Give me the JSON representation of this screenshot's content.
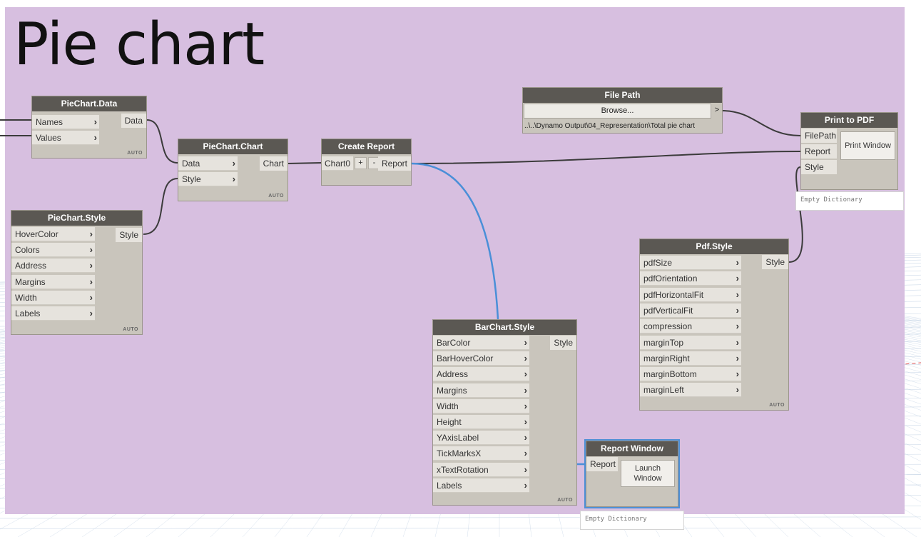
{
  "group": {
    "title": "Pie chart",
    "color": "#d7bfe0"
  },
  "nodes": {
    "piechart_data": {
      "title": "PieChart.Data",
      "inputs": [
        "Names",
        "Values"
      ],
      "output": "Data",
      "lacing": "AUTO"
    },
    "piechart_chart": {
      "title": "PieChart.Chart",
      "inputs": [
        "Data",
        "Style"
      ],
      "output": "Chart",
      "lacing": "AUTO"
    },
    "piechart_style": {
      "title": "PieChart.Style",
      "inputs": [
        "HoverColor",
        "Colors",
        "Address",
        "Margins",
        "Width",
        "Labels"
      ],
      "output": "Style",
      "lacing": "AUTO"
    },
    "create_report": {
      "title": "Create Report",
      "input": "Chart0",
      "add_label": "+",
      "remove_label": "-",
      "output": "Report"
    },
    "file_path": {
      "title": "File Path",
      "browse_label": "Browse...",
      "arrow_label": ">",
      "value": "..\\..\\Dynamo Output\\04_Representation\\Total pie chart"
    },
    "print_to_pdf": {
      "title": "Print to PDF",
      "inputs": [
        "FilePath",
        "Report",
        "Style"
      ],
      "button_label": "Print Window",
      "preview": "Empty Dictionary"
    },
    "pdf_style": {
      "title": "Pdf.Style",
      "inputs": [
        "pdfSize",
        "pdfOrientation",
        "pdfHorizontalFit",
        "pdfVerticalFit",
        "compression",
        "marginTop",
        "marginRight",
        "marginBottom",
        "marginLeft"
      ],
      "output": "Style",
      "lacing": "AUTO"
    },
    "barchart_style": {
      "title": "BarChart.Style",
      "inputs": [
        "BarColor",
        "BarHoverColor",
        "Address",
        "Margins",
        "Width",
        "Height",
        "YAxisLabel",
        "TickMarksX",
        "xTextRotation",
        "Labels"
      ],
      "output": "Style",
      "lacing": "AUTO"
    },
    "report_window": {
      "title": "Report Window",
      "input": "Report",
      "button_label": "Launch Window",
      "preview": "Empty Dictionary"
    }
  },
  "colors": {
    "wire": "#3b3b3b",
    "selected_wire": "#4a8fd8",
    "node_header": "#5b5853",
    "node_body": "#c9c5bc",
    "port": "#e6e3dd"
  }
}
